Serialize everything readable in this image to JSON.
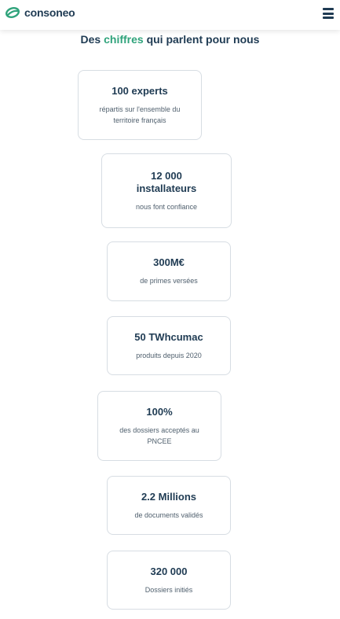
{
  "header": {
    "logo_text": "consoneo",
    "logo_color": "#2fa37b",
    "menu_icon": "hamburger-menu-icon"
  },
  "section": {
    "title_prefix": "Des ",
    "title_accent": "chiffres",
    "title_suffix": " qui parlent pour nous",
    "accent_color": "#2fa37b",
    "text_color": "#1f3b53"
  },
  "stats": [
    {
      "value": "100 experts",
      "description": "répartis sur l'ensemble du territoire français"
    },
    {
      "value": "12 000 installateurs",
      "description": "nous font confiance"
    },
    {
      "value": "300M€",
      "description": "de primes versées"
    },
    {
      "value": "50 TWhcumac",
      "description": "produits depuis 2020"
    },
    {
      "value": "100%",
      "description": "des dossiers acceptés au PNCEE"
    },
    {
      "value": "2.2 Millions",
      "description": "de documents validés"
    },
    {
      "value": "320 000",
      "description": "Dossiers initiés"
    }
  ]
}
